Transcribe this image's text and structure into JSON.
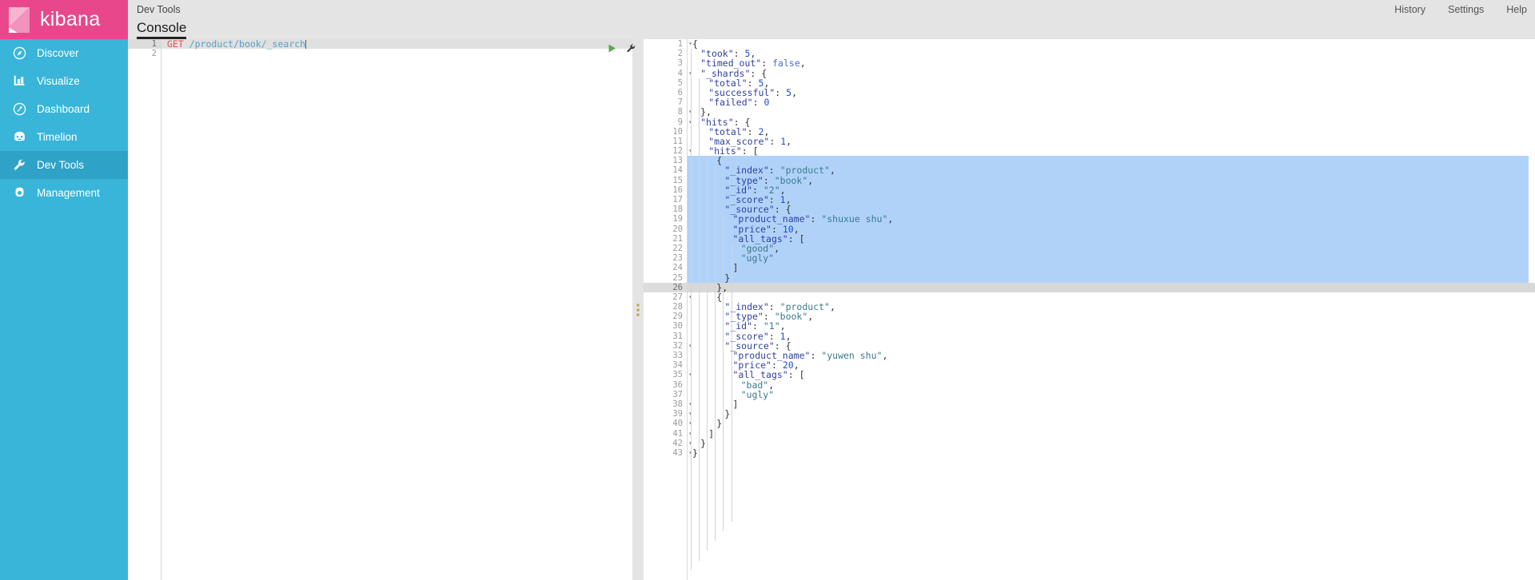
{
  "brand": {
    "name": "kibana",
    "color": "#e8488b",
    "sidebar_color": "#38b5d9",
    "active_color": "#2ea3c7"
  },
  "sidebar": {
    "items": [
      {
        "label": "Discover",
        "icon": "compass-icon",
        "active": false
      },
      {
        "label": "Visualize",
        "icon": "bar-chart-icon",
        "active": false
      },
      {
        "label": "Dashboard",
        "icon": "dashboard-icon",
        "active": false
      },
      {
        "label": "Timelion",
        "icon": "timelion-icon",
        "active": false
      },
      {
        "label": "Dev Tools",
        "icon": "wrench-icon",
        "active": true
      },
      {
        "label": "Management",
        "icon": "gear-icon",
        "active": false
      }
    ]
  },
  "header": {
    "title": "Dev Tools",
    "links": [
      {
        "label": "History"
      },
      {
        "label": "Settings"
      },
      {
        "label": "Help"
      }
    ]
  },
  "tabs": [
    {
      "label": "Console",
      "active": true
    }
  ],
  "request": {
    "method": "GET",
    "path": "/product/book/_search",
    "line_numbers": [
      "1",
      "2"
    ],
    "current_line": 1,
    "actions": [
      {
        "name": "play-button",
        "label": "Send request"
      },
      {
        "name": "wrench-button",
        "label": "Request options"
      }
    ]
  },
  "response": {
    "selection_start_line": 13,
    "selection_end_line": 25,
    "cursor_line": 26,
    "lines": [
      {
        "n": 1,
        "fold": true,
        "indent": 0,
        "text": "{"
      },
      {
        "n": 2,
        "fold": false,
        "indent": 1,
        "text": "\"took\": 5,"
      },
      {
        "n": 3,
        "fold": false,
        "indent": 1,
        "text": "\"timed_out\": false,"
      },
      {
        "n": 4,
        "fold": true,
        "indent": 1,
        "text": "\"_shards\": {"
      },
      {
        "n": 5,
        "fold": false,
        "indent": 2,
        "text": "\"total\": 5,"
      },
      {
        "n": 6,
        "fold": false,
        "indent": 2,
        "text": "\"successful\": 5,"
      },
      {
        "n": 7,
        "fold": false,
        "indent": 2,
        "text": "\"failed\": 0"
      },
      {
        "n": 8,
        "fold": true,
        "indent": 1,
        "text": "},"
      },
      {
        "n": 9,
        "fold": true,
        "indent": 1,
        "text": "\"hits\": {"
      },
      {
        "n": 10,
        "fold": false,
        "indent": 2,
        "text": "\"total\": 2,"
      },
      {
        "n": 11,
        "fold": false,
        "indent": 2,
        "text": "\"max_score\": 1,"
      },
      {
        "n": 12,
        "fold": true,
        "indent": 2,
        "text": "\"hits\": ["
      },
      {
        "n": 13,
        "fold": true,
        "indent": 3,
        "text": "{"
      },
      {
        "n": 14,
        "fold": false,
        "indent": 4,
        "text": "\"_index\": \"product\","
      },
      {
        "n": 15,
        "fold": false,
        "indent": 4,
        "text": "\"_type\": \"book\","
      },
      {
        "n": 16,
        "fold": false,
        "indent": 4,
        "text": "\"_id\": \"2\","
      },
      {
        "n": 17,
        "fold": false,
        "indent": 4,
        "text": "\"_score\": 1,"
      },
      {
        "n": 18,
        "fold": true,
        "indent": 4,
        "text": "\"_source\": {"
      },
      {
        "n": 19,
        "fold": false,
        "indent": 5,
        "text": "\"product_name\": \"shuxue shu\","
      },
      {
        "n": 20,
        "fold": false,
        "indent": 5,
        "text": "\"price\": 10,"
      },
      {
        "n": 21,
        "fold": true,
        "indent": 5,
        "text": "\"all_tags\": ["
      },
      {
        "n": 22,
        "fold": false,
        "indent": 6,
        "text": "\"good\","
      },
      {
        "n": 23,
        "fold": false,
        "indent": 6,
        "text": "\"ugly\""
      },
      {
        "n": 24,
        "fold": true,
        "indent": 5,
        "text": "]"
      },
      {
        "n": 25,
        "fold": true,
        "indent": 4,
        "text": "}"
      },
      {
        "n": 26,
        "fold": true,
        "indent": 3,
        "text": "},"
      },
      {
        "n": 27,
        "fold": true,
        "indent": 3,
        "text": "{"
      },
      {
        "n": 28,
        "fold": false,
        "indent": 4,
        "text": "\"_index\": \"product\","
      },
      {
        "n": 29,
        "fold": false,
        "indent": 4,
        "text": "\"_type\": \"book\","
      },
      {
        "n": 30,
        "fold": false,
        "indent": 4,
        "text": "\"_id\": \"1\","
      },
      {
        "n": 31,
        "fold": false,
        "indent": 4,
        "text": "\"_score\": 1,"
      },
      {
        "n": 32,
        "fold": true,
        "indent": 4,
        "text": "\"_source\": {"
      },
      {
        "n": 33,
        "fold": false,
        "indent": 5,
        "text": "\"product_name\": \"yuwen shu\","
      },
      {
        "n": 34,
        "fold": false,
        "indent": 5,
        "text": "\"price\": 20,"
      },
      {
        "n": 35,
        "fold": true,
        "indent": 5,
        "text": "\"all_tags\": ["
      },
      {
        "n": 36,
        "fold": false,
        "indent": 6,
        "text": "\"bad\","
      },
      {
        "n": 37,
        "fold": false,
        "indent": 6,
        "text": "\"ugly\""
      },
      {
        "n": 38,
        "fold": true,
        "indent": 5,
        "text": "]"
      },
      {
        "n": 39,
        "fold": true,
        "indent": 4,
        "text": "}"
      },
      {
        "n": 40,
        "fold": true,
        "indent": 3,
        "text": "}"
      },
      {
        "n": 41,
        "fold": true,
        "indent": 2,
        "text": "]"
      },
      {
        "n": 42,
        "fold": true,
        "indent": 1,
        "text": "}"
      },
      {
        "n": 43,
        "fold": true,
        "indent": 0,
        "text": "}"
      }
    ],
    "body": {
      "took": 5,
      "timed_out": false,
      "_shards": {
        "total": 5,
        "successful": 5,
        "failed": 0
      },
      "hits": {
        "total": 2,
        "max_score": 1,
        "hits": [
          {
            "_index": "product",
            "_type": "book",
            "_id": "2",
            "_score": 1,
            "_source": {
              "product_name": "shuxue shu",
              "price": 10,
              "all_tags": [
                "good",
                "ugly"
              ]
            }
          },
          {
            "_index": "product",
            "_type": "book",
            "_id": "1",
            "_score": 1,
            "_source": {
              "product_name": "yuwen shu",
              "price": 20,
              "all_tags": [
                "bad",
                "ugly"
              ]
            }
          }
        ]
      }
    }
  },
  "splitter": {
    "name": "pane-resize-handle"
  }
}
